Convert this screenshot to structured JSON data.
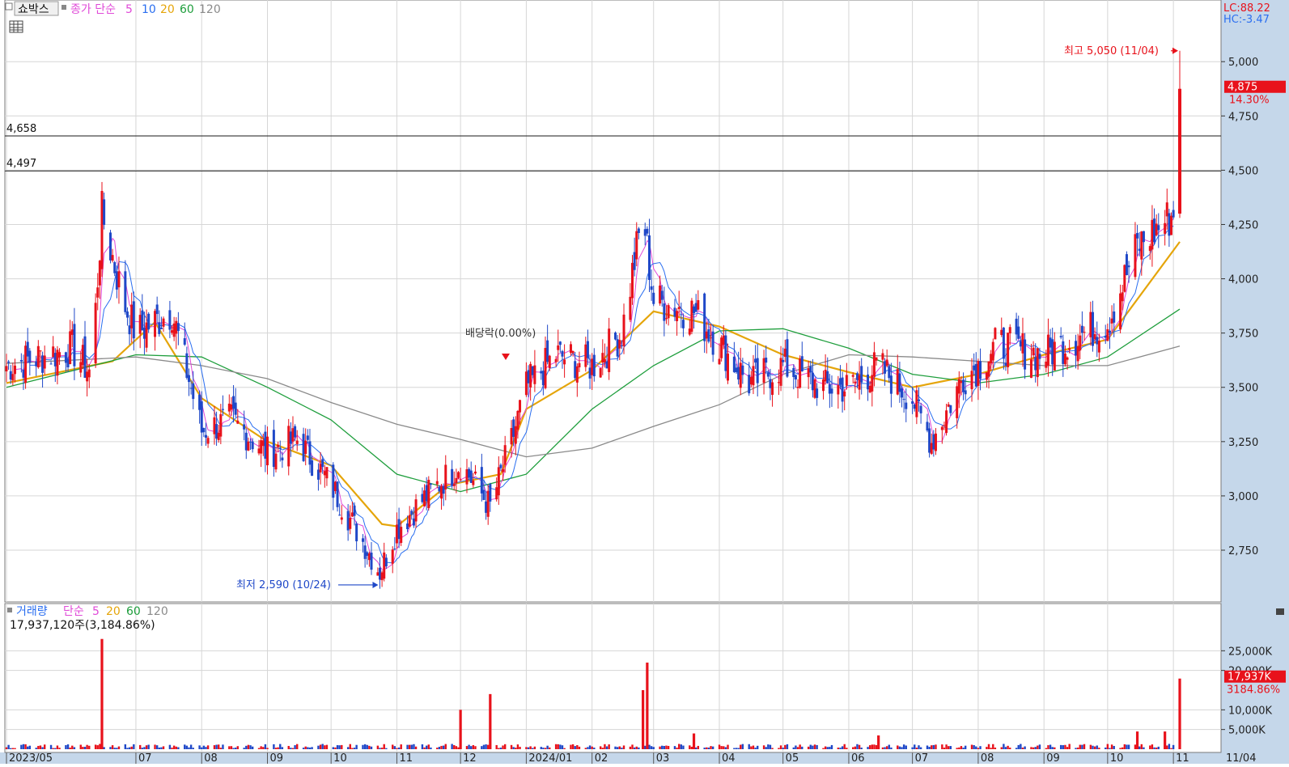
{
  "header": {
    "stock_name": "쇼박스",
    "price_label": "종가 단순",
    "ma_periods": [
      "5",
      "10",
      "20",
      "60",
      "120"
    ],
    "volume_label": "거래량",
    "volume_ma_label": "단순",
    "volume_ma_periods": [
      "5",
      "20",
      "60",
      "120"
    ],
    "volume_info": "17,937,120주(3,184.86%)"
  },
  "colors": {
    "up": "#e8121b",
    "down": "#1f48c8",
    "ma5": "#e04ad8",
    "ma10": "#2a6ef0",
    "ma20": "#e5a50a",
    "ma60": "#1e9e3c",
    "ma120": "#8a8a8a",
    "grid": "#d6d6d6",
    "axis_bg": "#c5d7ea"
  },
  "right_axis": {
    "lc": "LC:88.22",
    "hc": "HC:-3.47",
    "price_ticks": [
      "5,000",
      "4,750",
      "4,500",
      "4,250",
      "4,000",
      "3,750",
      "3,500",
      "3,250",
      "3,000",
      "2,750"
    ],
    "price_tick_values": [
      5000,
      4750,
      4500,
      4250,
      4000,
      3750,
      3500,
      3250,
      3000,
      2750
    ],
    "current_price": "4,875",
    "current_change": "14.30%",
    "volume_ticks": [
      "25,000K",
      "20,000K",
      "10,000K",
      "5,000K"
    ],
    "volume_tick_values": [
      25000,
      20000,
      10000,
      5000
    ],
    "current_volume": "17,937K",
    "current_volume_pct": "3184.86%"
  },
  "annotations": {
    "high": "최고 5,050 (11/04)",
    "low": "최저 2,590 (10/24)",
    "dividend": "배당락(0.00%)",
    "hline1": "4,658",
    "hline2": "4,497"
  },
  "x_axis": {
    "labels": [
      "2023/05",
      "07",
      "08",
      "09",
      "10",
      "11",
      "12",
      "2024/01",
      "02",
      "03",
      "04",
      "05",
      "06",
      "07",
      "08",
      "09",
      "10",
      "11"
    ],
    "label_dates": [
      "2023-05",
      "2023-07",
      "2023-08",
      "2023-09",
      "2023-10",
      "2023-11",
      "2023-12",
      "2024-01",
      "2024-02",
      "2024-03",
      "2024-04",
      "2024-05",
      "2024-06",
      "2024-07",
      "2024-08",
      "2024-09",
      "2024-10",
      "2024-11"
    ],
    "right_label": "11/04"
  },
  "chart_data": {
    "type": "candlestick",
    "title": "쇼박스",
    "x_range": [
      "2023-05",
      "2024-11-04"
    ],
    "y_range": [
      2560,
      5120
    ],
    "volume_unit": "K",
    "volume_range": [
      0,
      30000
    ],
    "horizontal_lines": [
      4658,
      4497
    ],
    "price_path": [
      {
        "date": "2023-05",
        "close": 3600
      },
      {
        "date": "2023-06-01",
        "close": 3680
      },
      {
        "date": "2023-06-10",
        "close": 3560
      },
      {
        "date": "2023-06-15",
        "close": 4300
      },
      {
        "date": "2023-06-25",
        "close": 3900
      },
      {
        "date": "2023-07",
        "close": 3750
      },
      {
        "date": "2023-07-18",
        "close": 3850
      },
      {
        "date": "2023-08",
        "close": 3300
      },
      {
        "date": "2023-08-15",
        "close": 3350
      },
      {
        "date": "2023-09",
        "close": 3200
      },
      {
        "date": "2023-09-15",
        "close": 3260
      },
      {
        "date": "2023-10",
        "close": 3050
      },
      {
        "date": "2023-10-24",
        "close": 2650
      },
      {
        "date": "2023-11",
        "close": 2850
      },
      {
        "date": "2023-11-15",
        "close": 3000
      },
      {
        "date": "2023-12",
        "close": 3150
      },
      {
        "date": "2023-12-15",
        "close": 2950
      },
      {
        "date": "2023-12-25",
        "close": 3250
      },
      {
        "date": "2024-01",
        "close": 3500
      },
      {
        "date": "2024-01-15",
        "close": 3650
      },
      {
        "date": "2024-02",
        "close": 3600
      },
      {
        "date": "2024-02-15",
        "close": 3750
      },
      {
        "date": "2024-02-25",
        "close": 4300
      },
      {
        "date": "2024-03",
        "close": 3900
      },
      {
        "date": "2024-03-20",
        "close": 3850
      },
      {
        "date": "2024-04",
        "close": 3700
      },
      {
        "date": "2024-04-15",
        "close": 3520
      },
      {
        "date": "2024-05",
        "close": 3600
      },
      {
        "date": "2024-05-20",
        "close": 3500
      },
      {
        "date": "2024-06",
        "close": 3500
      },
      {
        "date": "2024-06-15",
        "close": 3600
      },
      {
        "date": "2024-07",
        "close": 3450
      },
      {
        "date": "2024-07-10",
        "close": 3250
      },
      {
        "date": "2024-07-25",
        "close": 3550
      },
      {
        "date": "2024-08",
        "close": 3600
      },
      {
        "date": "2024-08-10",
        "close": 3700
      },
      {
        "date": "2024-09",
        "close": 3650
      },
      {
        "date": "2024-09-20",
        "close": 3750
      },
      {
        "date": "2024-10",
        "close": 3800
      },
      {
        "date": "2024-10-15",
        "close": 4150
      },
      {
        "date": "2024-11-01",
        "close": 4300
      },
      {
        "date": "2024-11-04",
        "close": 4875
      }
    ],
    "last_candle": {
      "date": "2024-11-04",
      "open": 4300,
      "high": 5050,
      "low": 4280,
      "close": 4875
    },
    "ma_series": [
      {
        "name": "20",
        "points": [
          {
            "date": "2023-05",
            "value": 3520
          },
          {
            "date": "2023-06-20",
            "value": 3620
          },
          {
            "date": "2023-07-10",
            "value": 3800
          },
          {
            "date": "2023-08",
            "value": 3450
          },
          {
            "date": "2023-09",
            "value": 3250
          },
          {
            "date": "2023-10",
            "value": 3140
          },
          {
            "date": "2023-10-25",
            "value": 2870
          },
          {
            "date": "2023-11",
            "value": 2860
          },
          {
            "date": "2023-11-25",
            "value": 3050
          },
          {
            "date": "2023-12-20",
            "value": 3100
          },
          {
            "date": "2024-01",
            "value": 3400
          },
          {
            "date": "2024-02",
            "value": 3580
          },
          {
            "date": "2024-03",
            "value": 3850
          },
          {
            "date": "2024-04",
            "value": 3780
          },
          {
            "date": "2024-05",
            "value": 3650
          },
          {
            "date": "2024-06",
            "value": 3570
          },
          {
            "date": "2024-07",
            "value": 3500
          },
          {
            "date": "2024-08",
            "value": 3560
          },
          {
            "date": "2024-09",
            "value": 3650
          },
          {
            "date": "2024-10",
            "value": 3720
          },
          {
            "date": "2024-11-04",
            "value": 4170
          }
        ]
      },
      {
        "name": "60",
        "points": [
          {
            "date": "2023-05",
            "value": 3500
          },
          {
            "date": "2023-07",
            "value": 3650
          },
          {
            "date": "2023-08",
            "value": 3640
          },
          {
            "date": "2023-09",
            "value": 3500
          },
          {
            "date": "2023-10",
            "value": 3350
          },
          {
            "date": "2023-11",
            "value": 3100
          },
          {
            "date": "2023-12",
            "value": 3020
          },
          {
            "date": "2024-01",
            "value": 3100
          },
          {
            "date": "2024-02",
            "value": 3400
          },
          {
            "date": "2024-03",
            "value": 3600
          },
          {
            "date": "2024-04",
            "value": 3760
          },
          {
            "date": "2024-05",
            "value": 3770
          },
          {
            "date": "2024-06",
            "value": 3680
          },
          {
            "date": "2024-07",
            "value": 3560
          },
          {
            "date": "2024-08",
            "value": 3520
          },
          {
            "date": "2024-09",
            "value": 3560
          },
          {
            "date": "2024-10",
            "value": 3640
          },
          {
            "date": "2024-11-04",
            "value": 3860
          }
        ]
      },
      {
        "name": "120",
        "points": [
          {
            "date": "2023-05",
            "value": 3610
          },
          {
            "date": "2023-07",
            "value": 3640
          },
          {
            "date": "2023-08",
            "value": 3600
          },
          {
            "date": "2023-09",
            "value": 3540
          },
          {
            "date": "2023-10",
            "value": 3430
          },
          {
            "date": "2023-11",
            "value": 3330
          },
          {
            "date": "2023-12",
            "value": 3260
          },
          {
            "date": "2024-01",
            "value": 3180
          },
          {
            "date": "2024-02",
            "value": 3220
          },
          {
            "date": "2024-03",
            "value": 3320
          },
          {
            "date": "2024-04",
            "value": 3420
          },
          {
            "date": "2024-05",
            "value": 3560
          },
          {
            "date": "2024-06",
            "value": 3650
          },
          {
            "date": "2024-07",
            "value": 3640
          },
          {
            "date": "2024-08",
            "value": 3620
          },
          {
            "date": "2024-09",
            "value": 3600
          },
          {
            "date": "2024-10",
            "value": 3600
          },
          {
            "date": "2024-11-04",
            "value": 3690
          }
        ]
      }
    ],
    "volume_spikes": [
      {
        "date": "2023-06-15",
        "value": 28000
      },
      {
        "date": "2023-12-01",
        "value": 10000
      },
      {
        "date": "2023-12-15",
        "value": 14000
      },
      {
        "date": "2024-02-25",
        "value": 15000
      },
      {
        "date": "2024-02-27",
        "value": 22000
      },
      {
        "date": "2024-03-20",
        "value": 4000
      },
      {
        "date": "2024-06-15",
        "value": 3500
      },
      {
        "date": "2024-10-15",
        "value": 4500
      },
      {
        "date": "2024-10-28",
        "value": 4500
      },
      {
        "date": "2024-11-04",
        "value": 17937
      }
    ],
    "volume_base": 900
  }
}
